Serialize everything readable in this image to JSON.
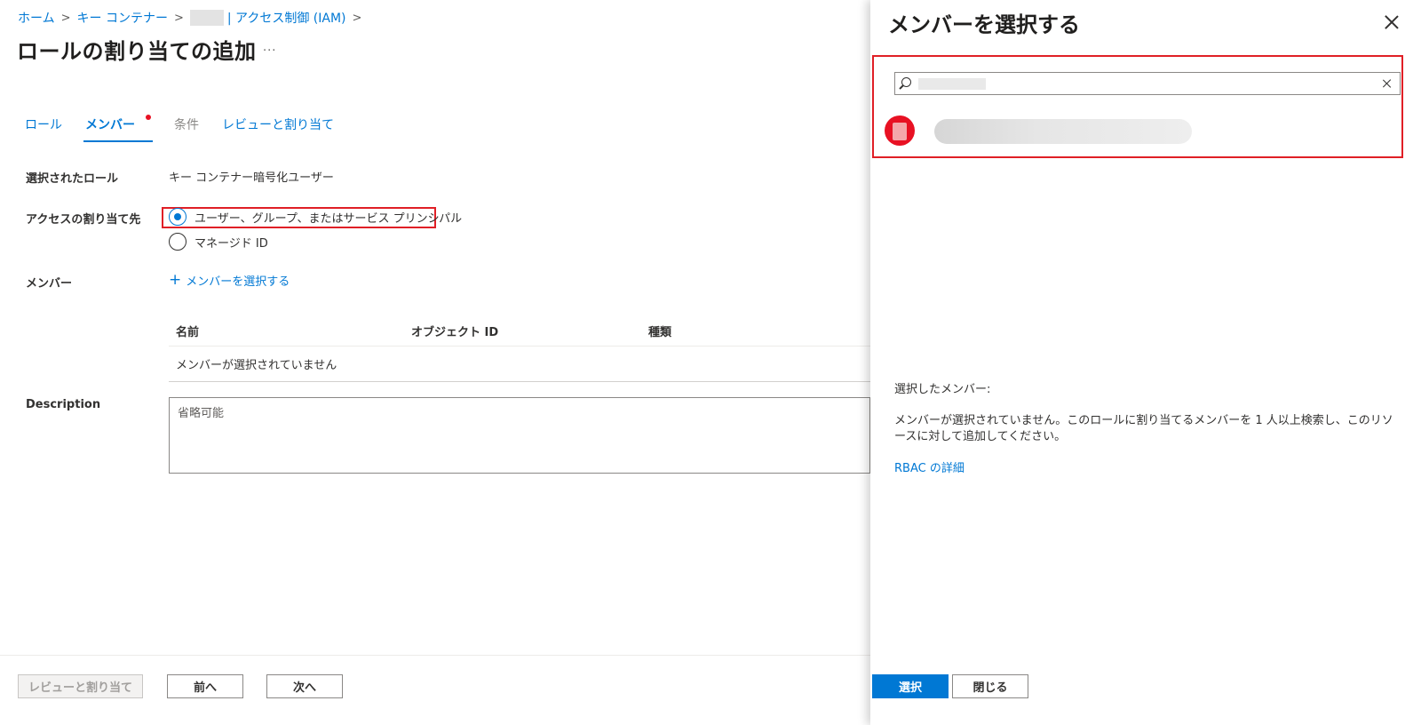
{
  "breadcrumb": {
    "home": "ホーム",
    "keyvault": "キー コンテナー",
    "iam": "| アクセス制御 (IAM)"
  },
  "page": {
    "title": "ロールの割り当ての追加",
    "more": "..."
  },
  "tabs": [
    {
      "label": "ロール"
    },
    {
      "label": "メンバー"
    },
    {
      "label": "条件"
    },
    {
      "label": "レビューと割り当て"
    }
  ],
  "form": {
    "selected_role_label": "選択されたロール",
    "selected_role_value": "キー コンテナー暗号化ユーザー",
    "assign_to_label": "アクセスの割り当て先",
    "assign_option_users": "ユーザー、グループ、またはサービス プリンシパル",
    "assign_option_managed": "マネージド ID",
    "members_label": "メンバー",
    "add_members": "メンバーを選択する",
    "description_label": "Description",
    "description_placeholder": "省略可能"
  },
  "member_table": {
    "columns": [
      "名前",
      "オブジェクト ID",
      "種類"
    ],
    "empty": "メンバーが選択されていません"
  },
  "footer": {
    "review": "レビューと割り当て",
    "prev": "前へ",
    "next": "次へ"
  },
  "panel": {
    "title": "メンバーを選択する",
    "selected_label": "選択したメンバー:",
    "selected_info": "メンバーが選択されていません。このロールに割り当てるメンバーを 1 人以上検索し、このリソースに対して追加してください。",
    "rbac_link": "RBAC の詳細",
    "select_button": "選択",
    "close_button": "閉じる"
  },
  "colors": {
    "accent": "#0078d4",
    "highlight": "#e01f26",
    "avatar": "#e81123"
  }
}
